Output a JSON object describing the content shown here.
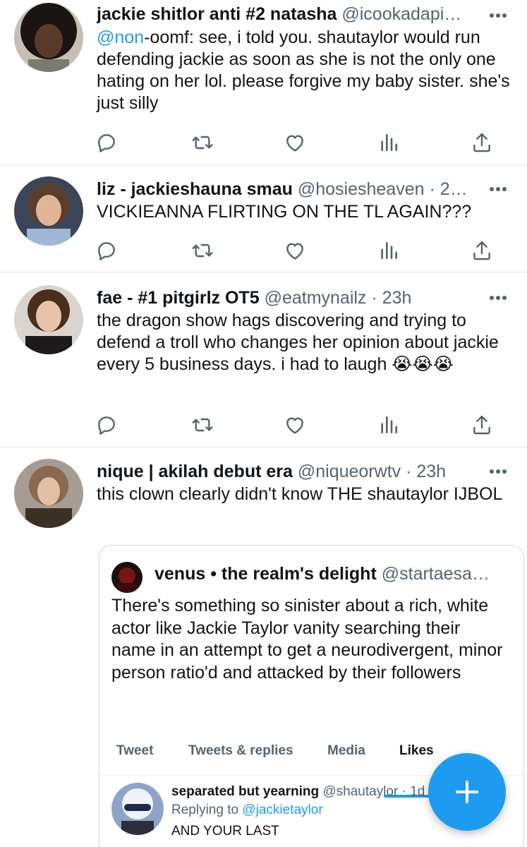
{
  "tweets": [
    {
      "name": "jackie shitlor anti #2 natasha",
      "handle": "@icookadapi…",
      "time": "",
      "mention": "@non",
      "text": "-oomf: see, i told you. shautaylor would run defending jackie as soon as she is not the only one hating on her lol. please forgive my baby sister. she's just silly"
    },
    {
      "name": "liz - jackieshauna smau",
      "handle": "@hosiesheaven",
      "time": "2…",
      "text": "VICKIEANNA FLIRTING ON THE TL AGAIN???"
    },
    {
      "name": "fae - #1 pitgirlz OT5",
      "handle": "@eatmynailz",
      "time": "23h",
      "text": "the dragon show hags discovering and trying to defend a troll who changes her opinion about jackie every 5 business days. i had to laugh 😭😭😭"
    },
    {
      "name": "nique | akilah debut era",
      "handle": "@niqueorwtv",
      "time": "23h",
      "text": "this clown clearly didn't know THE shautaylor IJBOL"
    }
  ],
  "quote": {
    "name": "venus • the realm's delight",
    "handle": "@startaesa…",
    "text": "There's something so sinister about a rich, white actor like Jackie Taylor vanity searching their name in an attempt to get a neurodivergent, minor person ratio'd and attacked by their followers",
    "tabs": [
      "Tweet",
      "Tweets & replies",
      "Media",
      "Likes"
    ],
    "active_tab": "Likes",
    "embedded": {
      "name": "separated but yearning",
      "handle": "@shautaylor",
      "time": "1d",
      "replying_prefix": "Replying to",
      "replying_to": "@jackietaylor",
      "text": "AND YOUR LAST"
    }
  },
  "separator": "·",
  "colors": {
    "accent": "#1d9bf0",
    "text_primary": "#0f1419",
    "text_secondary": "#536471",
    "divider": "#e1e8ed"
  },
  "icons": [
    "reply-icon",
    "retweet-icon",
    "like-icon",
    "views-icon",
    "share-icon",
    "more-icon",
    "compose-plus-icon"
  ]
}
